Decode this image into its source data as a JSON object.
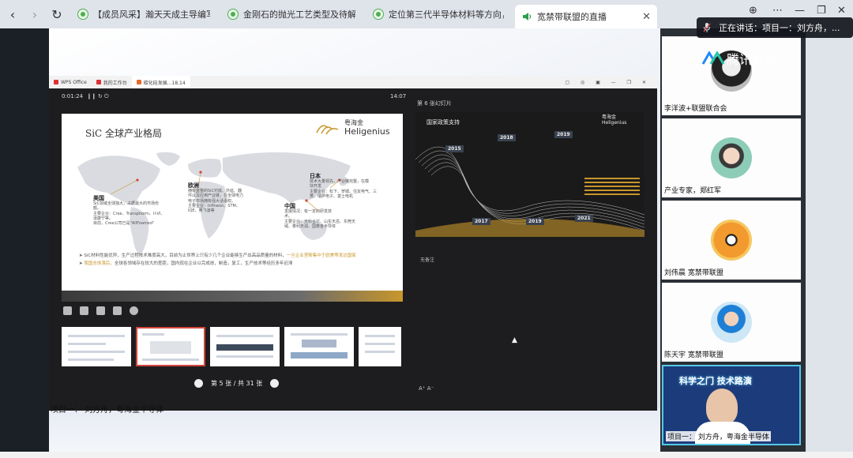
{
  "browser": {
    "tabs": [
      {
        "title": "【成员风采】瀚天天成主导编写的"
      },
      {
        "title": "金刚石的抛光工艺类型及待解决问"
      },
      {
        "title": "定位第三代半导体材料等方向，山"
      },
      {
        "title": "宽禁带联盟的直播",
        "active": true
      }
    ]
  },
  "speaking": {
    "label": "正在讲话：项目一：刘方舟，..."
  },
  "meeting": {
    "app_name": "腾讯会议",
    "caption": "项目一： 刘方舟，粤海金半导体"
  },
  "ppt": {
    "wps_tabs": [
      "WPS Office",
      "我的工作台",
      "碳化硅发展...18.14"
    ],
    "elapsed": "0:01:24",
    "clock": "14:07",
    "pager": "第 5 张 / 共 31 张",
    "next_label": "第 6 张幻灯片",
    "notes_label": "无备注",
    "font_buttons": "A⁺  A⁻",
    "current_slide": {
      "title": "SiC 全球产业格局",
      "brand_cn": "粤海金",
      "brand_en": "Heligenius",
      "regions": [
        {
          "name": "美国",
          "desc": "SiC领域全球独大，占据最大的市场份\n额。\n主要企业：Cree、Transphorm、II-VI、\n道康宁等。\n目前，Cree公司已是\"AllFoamed\""
        },
        {
          "name": "欧洲",
          "desc": "拥有完整的SiC衬底、外延、器\n件以及应用产业链，在全球电力\n电子市场拥有强大话语权。\n主要企业：Infineon、STM、\nIQE、英飞凌等"
        },
        {
          "name": "日本",
          "desc": "技术大量领先，产业链完整，在模\n块开发\n主要企业：松下、罗姆、住友电气、三\n菱、瑞萨电子、富士电机"
        },
        {
          "name": "中国",
          "desc": "发展情况：有一定的研发技\n术。\n主要企业：天科合达、山东天岳、东莞天\n域、泰科天润、国泰金半导体"
        }
      ],
      "bullet1_text": "SiC材料性能优异，生产过程技术难度高大，目前为止世界上只有少几个企业能够生产出高品质量的材料，",
      "bullet1_highlight": "一旦企业垄断集中于欧美等发达国家",
      "bullet2_highlight": "我国总体落后，",
      "bullet2_text": "全球各领域存在较大的差距，国内现在企业以完成技，制造，复工，生产技术等经历多年迟滞"
    },
    "next_slide": {
      "title": "国家政策支持",
      "brand_cn": "粤海金",
      "brand_en": "Heligenius",
      "years": [
        "2015",
        "2018",
        "2019",
        "2017",
        "2019",
        "2021"
      ]
    }
  },
  "participants": [
    {
      "name": "李洋波+联盟联合会"
    },
    {
      "name": "产业专家，郑红军"
    },
    {
      "name": "刘伟晨 宽禁带联盟"
    },
    {
      "name": "陈天宇 宽禁带联盟"
    },
    {
      "name": "项目一： 刘方舟，粤海金半导体",
      "video": true,
      "banner": "科学之门 技术路演"
    }
  ],
  "colors": {
    "accent": "#c8962b",
    "highlight_border": "#54c9e6",
    "active_thumb": "#d2453c"
  }
}
